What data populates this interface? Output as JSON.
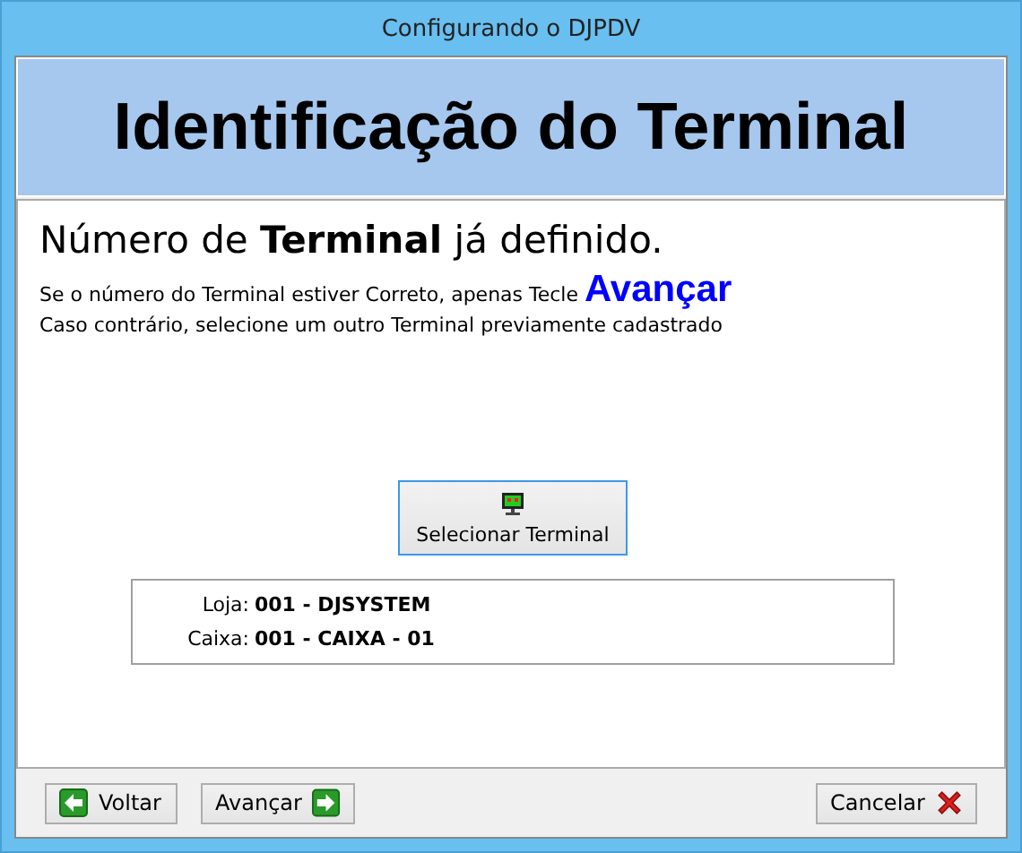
{
  "window": {
    "title": "Configurando o DJPDV"
  },
  "header": {
    "title": "Identificação do Terminal"
  },
  "content": {
    "heading": "Número de **Terminal** já definido.",
    "instructions": [
      "Se o número do Terminal estiver Correto, apenas Tecle **Avançar**",
      "Caso contrário, selecione um outro Terminal previamente cadastrado"
    ],
    "select_button": {
      "label": "Selecionar Terminal"
    },
    "info": [
      {
        "label": "Loja:",
        "value": "001 - DJSYSTEM"
      },
      {
        "label": "Caixa:",
        "value": "001 - CAIXA - 01"
      }
    ]
  },
  "buttons": [
    {
      "kind": "back",
      "label": "Voltar"
    },
    {
      "kind": "next",
      "label": "Avançar"
    },
    {
      "kind": "cancel",
      "label": "Cancelar"
    }
  ]
}
